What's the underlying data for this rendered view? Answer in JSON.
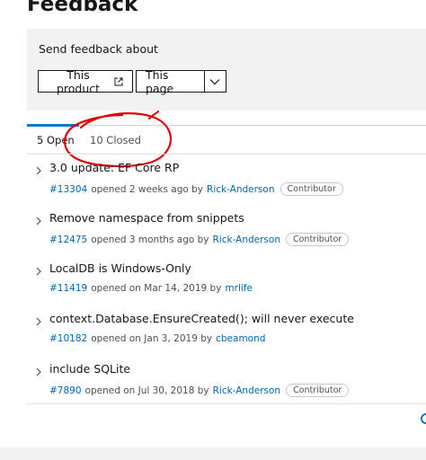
{
  "page": {
    "title": "Feedback"
  },
  "feedback_panel": {
    "label": "Send feedback about",
    "product_button": "This product",
    "page_button": "This page"
  },
  "tabs": [
    {
      "label": "5 Open",
      "active": true
    },
    {
      "label": "10 Closed",
      "active": false
    }
  ],
  "issues": [
    {
      "title": "3.0 update: EF Core RP",
      "number": "#13304",
      "opened": "opened 2 weeks ago by",
      "author": "Rick-Anderson",
      "badge": "Contributor"
    },
    {
      "title": "Remove namespace from snippets",
      "number": "#12475",
      "opened": "opened 3 months ago by",
      "author": "Rick-Anderson",
      "badge": "Contributor"
    },
    {
      "title": "LocalDB is Windows-Only",
      "number": "#11419",
      "opened": "opened on Mar 14, 2019 by",
      "author": "mrlife",
      "badge": ""
    },
    {
      "title": "context.Database.EnsureCreated(); will never execute",
      "number": "#10182",
      "opened": "opened on Jan 3, 2019 by",
      "author": "cbeamond",
      "badge": ""
    },
    {
      "title": "include SQLite",
      "number": "#7890",
      "opened": "opened on Jul 30, 2018 by",
      "author": "Rick-Anderson",
      "badge": "Contributor"
    }
  ],
  "colors": {
    "accent": "#0078d4",
    "link": "#0065b3",
    "annotation": "#e00000"
  },
  "icons": {
    "external": "external-link-icon",
    "dropdown": "chevron-down-icon",
    "expand": "chevron-right-icon"
  }
}
